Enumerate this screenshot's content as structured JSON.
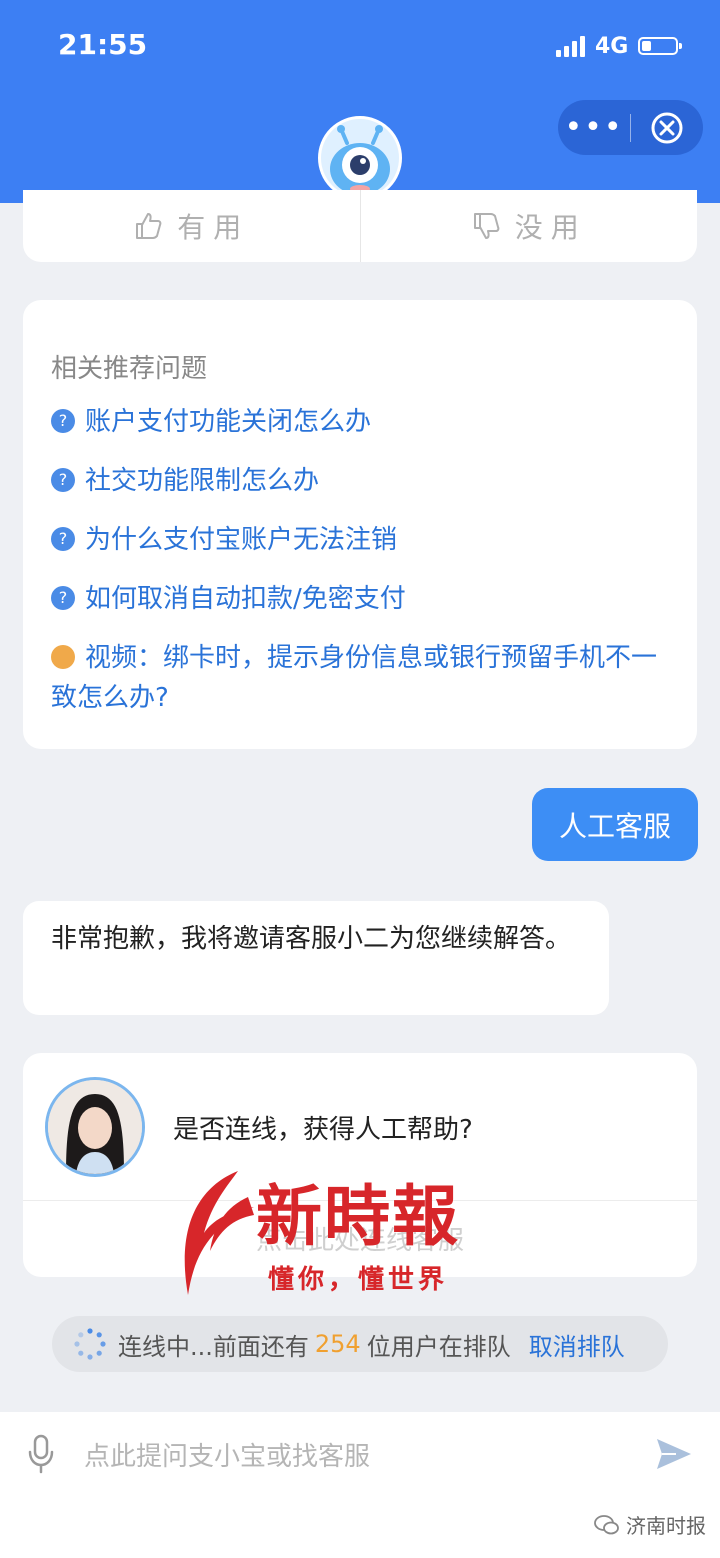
{
  "status_bar": {
    "time": "21:55",
    "network": "4G"
  },
  "feedback": {
    "useful": "有用",
    "useless": "没用"
  },
  "recommendations": {
    "title": "相关推荐问题",
    "items": [
      {
        "label": "账户支付功能关闭怎么办",
        "icon": "question-icon"
      },
      {
        "label": "社交功能限制怎么办",
        "icon": "question-icon"
      },
      {
        "label": "为什么支付宝账户无法注销",
        "icon": "question-icon"
      },
      {
        "label": "如何取消自动扣款/免密支付",
        "icon": "question-icon"
      },
      {
        "label": "视频：绑卡时，提示身份信息或银行预留手机不一致怎么办?",
        "icon": "video-doc-icon"
      }
    ]
  },
  "chat": {
    "user_message": "人工客服",
    "bot_message": "非常抱歉，我将邀请客服小二为您继续解答。",
    "handoff_question": "是否连线，获得人工帮助?",
    "handoff_action": "点击此处连线客服"
  },
  "watermark": {
    "title": "新時報",
    "subtitle": "懂你，懂世界"
  },
  "queue": {
    "prefix": "连线中...前面还有",
    "count": "254",
    "suffix": "位用户在排队",
    "cancel": "取消排队"
  },
  "composer": {
    "placeholder": "点此提问支小宝或找客服"
  },
  "source_label": "济南时报",
  "colors": {
    "header": "#3d7ff3",
    "link": "#2a73d8",
    "queue_count": "#f0a030",
    "user_bubble": "#3d8ef5"
  }
}
